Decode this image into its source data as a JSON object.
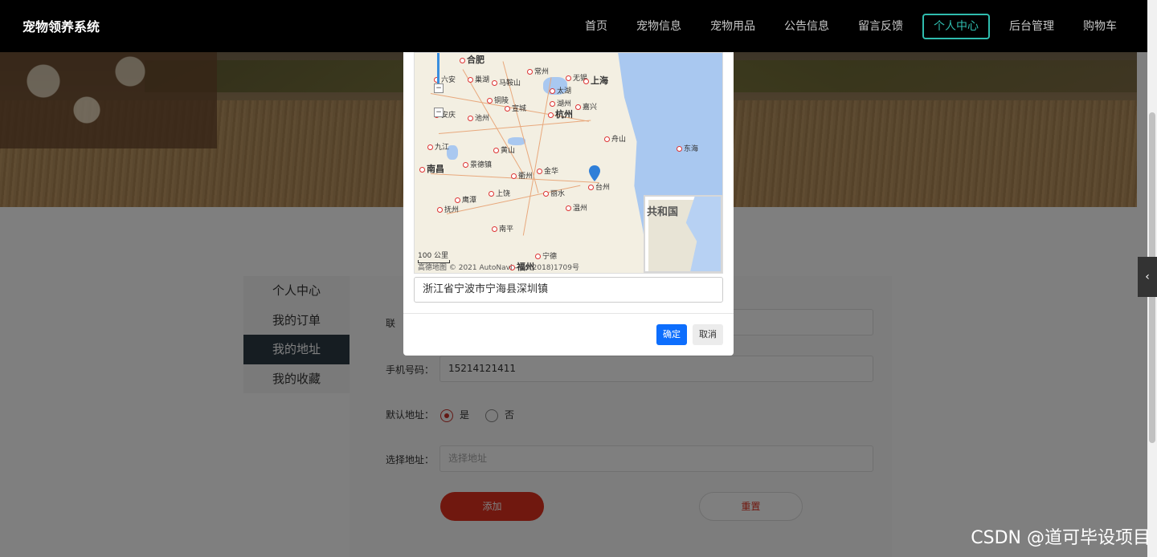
{
  "header": {
    "brand": "宠物领养系统",
    "nav": [
      "首页",
      "宠物信息",
      "宠物用品",
      "公告信息",
      "留言反馈",
      "个人中心",
      "后台管理",
      "购物车"
    ],
    "active_nav": "个人中心"
  },
  "side_menu": {
    "items": [
      "个人中心",
      "我的订单",
      "我的地址",
      "我的收藏"
    ],
    "active": "我的地址"
  },
  "form": {
    "contact_label": "联",
    "phone_label": "手机号码：",
    "phone_value": "15214121411",
    "default_label": "默认地址：",
    "default_yes": "是",
    "default_no": "否",
    "address_label": "选择地址：",
    "address_placeholder": "选择地址",
    "add_button": "添加",
    "reset_button": "重置"
  },
  "modal": {
    "address_value": "浙江省宁波市宁海县深圳镇",
    "ok_button": "确定",
    "cancel_button": "取消",
    "map": {
      "scale_label": "100 公里",
      "copyright": "高德地图 © 2021 AutoNavi - GS(2018)1709号",
      "minimap_label": "共和国",
      "sea_label": "东海",
      "cities": [
        {
          "name": "合肥",
          "big": true
        },
        {
          "name": "六安"
        },
        {
          "name": "巢湖"
        },
        {
          "name": "马鞍山"
        },
        {
          "name": "常州"
        },
        {
          "name": "无锡"
        },
        {
          "name": "上海",
          "big": true
        },
        {
          "name": "太湖"
        },
        {
          "name": "铜陵"
        },
        {
          "name": "宣城"
        },
        {
          "name": "湖州"
        },
        {
          "name": "嘉兴"
        },
        {
          "name": "安庆"
        },
        {
          "name": "池州"
        },
        {
          "name": "杭州",
          "big": true
        },
        {
          "name": "舟山"
        },
        {
          "name": "九江"
        },
        {
          "name": "黄山"
        },
        {
          "name": "南昌",
          "big": true
        },
        {
          "name": "景德镇"
        },
        {
          "name": "衢州"
        },
        {
          "name": "金华"
        },
        {
          "name": "台州"
        },
        {
          "name": "鹰潭"
        },
        {
          "name": "上饶"
        },
        {
          "name": "丽水"
        },
        {
          "name": "抚州"
        },
        {
          "name": "温州"
        },
        {
          "name": "南平"
        },
        {
          "name": "宁德"
        },
        {
          "name": "福州",
          "big": true
        }
      ]
    }
  },
  "watermark": "CSDN @道可毕设项目"
}
